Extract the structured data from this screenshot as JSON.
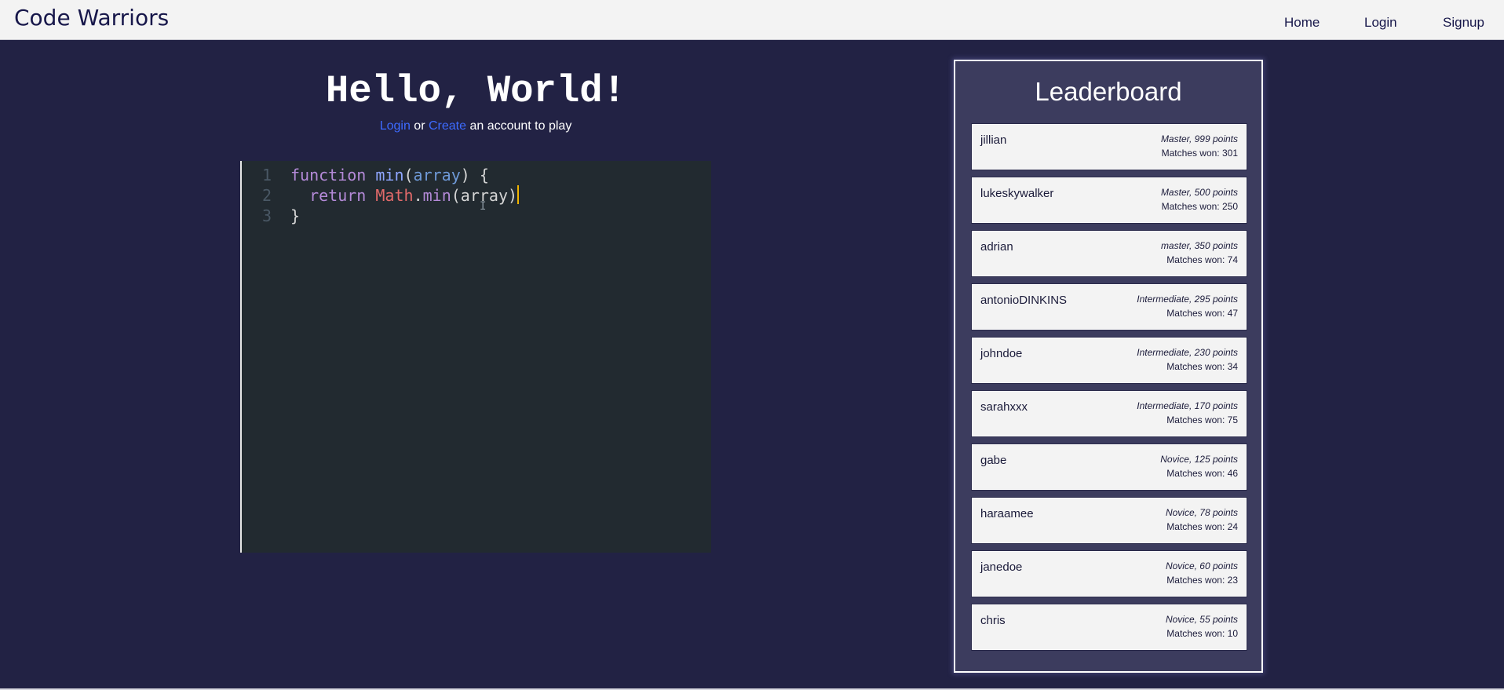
{
  "navbar": {
    "brand": "Code Warriors",
    "links": {
      "home": "Home",
      "login": "Login",
      "signup": "Signup"
    }
  },
  "hero": {
    "title": "Hello, World!",
    "login_link": "Login",
    "or_text": " or ",
    "create_link": "Create",
    "suffix_text": " an account to play",
    "link_color": "#3d6bff"
  },
  "editor": {
    "line_numbers": [
      "1",
      "2",
      "3"
    ],
    "lines": [
      [
        {
          "t": "function",
          "c": "kw"
        },
        {
          "t": " ",
          "c": "pl"
        },
        {
          "t": "min",
          "c": "fn"
        },
        {
          "t": "(",
          "c": "pl"
        },
        {
          "t": "array",
          "c": "var"
        },
        {
          "t": ") {",
          "c": "pl"
        }
      ],
      [
        {
          "t": "  ",
          "c": "pl"
        },
        {
          "t": "return",
          "c": "kw"
        },
        {
          "t": " ",
          "c": "pl"
        },
        {
          "t": "Math",
          "c": "cls"
        },
        {
          "t": ".",
          "c": "pl"
        },
        {
          "t": "min",
          "c": "kw"
        },
        {
          "t": "(array)",
          "c": "pl"
        }
      ],
      [
        {
          "t": "}",
          "c": "pl"
        }
      ]
    ],
    "colors": {
      "background": "#222a30",
      "keyword": "#b48ad8",
      "function": "#8fa6ff",
      "variable": "#6f9ad8",
      "class": "#e26a6a",
      "cursor": "#f0b400"
    }
  },
  "leaderboard": {
    "title": "Leaderboard",
    "entries": [
      {
        "name": "jillian",
        "rank": "Master, 999 points",
        "won": "Matches won: 301"
      },
      {
        "name": "lukeskywalker",
        "rank": "Master, 500 points",
        "won": "Matches won: 250"
      },
      {
        "name": "adrian",
        "rank": "master, 350 points",
        "won": "Matches won: 74"
      },
      {
        "name": "antonioDINKINS",
        "rank": "Intermediate, 295 points",
        "won": "Matches won: 47"
      },
      {
        "name": "johndoe",
        "rank": "Intermediate, 230 points",
        "won": "Matches won: 34"
      },
      {
        "name": "sarahxxx",
        "rank": "Intermediate, 170 points",
        "won": "Matches won: 75"
      },
      {
        "name": "gabe",
        "rank": "Novice, 125 points",
        "won": "Matches won: 46"
      },
      {
        "name": "haraamee",
        "rank": "Novice, 78 points",
        "won": "Matches won: 24"
      },
      {
        "name": "janedoe",
        "rank": "Novice, 60 points",
        "won": "Matches won: 23"
      },
      {
        "name": "chris",
        "rank": "Novice, 55 points",
        "won": "Matches won: 10"
      }
    ]
  },
  "theme": {
    "page_background": "#222244",
    "navbar_background": "#f3f3f3",
    "leaderboard_background": "#3c3c5e"
  }
}
